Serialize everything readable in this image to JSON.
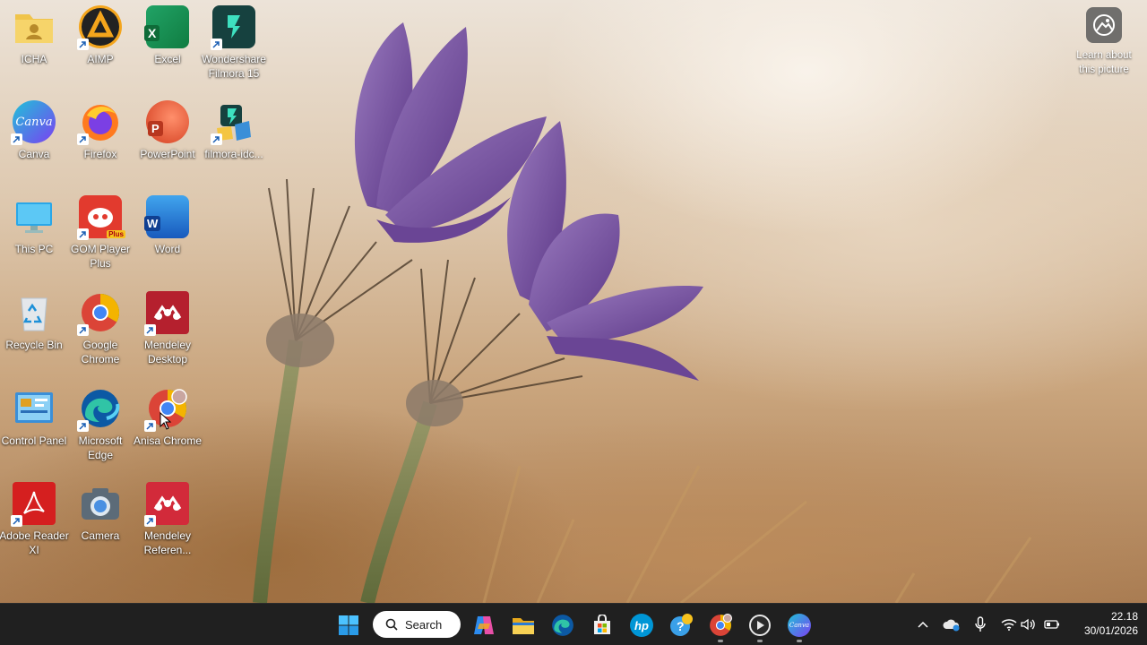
{
  "desktop": {
    "icons": [
      {
        "label": "ICHA"
      },
      {
        "label": "AIMP"
      },
      {
        "label": "Excel"
      },
      {
        "label": "Wondershare Filmora 15"
      },
      {
        "label": "Canva"
      },
      {
        "label": "Firefox"
      },
      {
        "label": "PowerPoint"
      },
      {
        "label": "filmora-idc..."
      },
      {
        "label": "This PC"
      },
      {
        "label": "GOM Player Plus"
      },
      {
        "label": "Word"
      },
      {
        "label": "Recycle Bin"
      },
      {
        "label": "Google Chrome"
      },
      {
        "label": "Mendeley Desktop"
      },
      {
        "label": "Control Panel"
      },
      {
        "label": "Microsoft Edge"
      },
      {
        "label": "Anisa Chrome"
      },
      {
        "label": "Adobe Reader XI"
      },
      {
        "label": "Camera"
      },
      {
        "label": "Mendeley Referen..."
      }
    ],
    "learn_about": {
      "label": "Learn about this picture"
    }
  },
  "taskbar": {
    "search": {
      "label": "Search"
    },
    "pinned": [
      "start",
      "copilot",
      "file-explorer",
      "edge",
      "store",
      "hp",
      "tips",
      "chrome",
      "media-player",
      "canva"
    ],
    "tray": {
      "time": "22.18",
      "date": "30/01/2026"
    }
  },
  "icon_text": {
    "canva": "Canva",
    "gom_badge": "Plus",
    "excel": "X",
    "word": "W",
    "powerpoint": "P",
    "hp": "hp",
    "canva_small": "Canva"
  },
  "colors": {
    "taskbar_bg": "#202020",
    "win_blue": "#0078d4",
    "flower_purple": "#7a4fa0"
  }
}
